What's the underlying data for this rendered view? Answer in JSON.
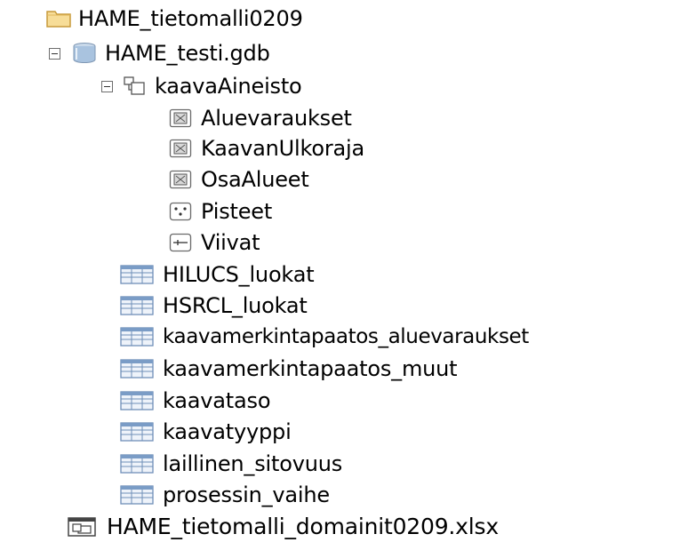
{
  "tree": {
    "root": {
      "label": "HAME_tietomalli0209",
      "icon": "folder-icon"
    },
    "gdb": {
      "label": "HAME_testi.gdb",
      "icon": "geodatabase-icon"
    },
    "dataset": {
      "label": "kaavaAineisto",
      "icon": "feature-dataset-icon"
    },
    "feature_classes": [
      {
        "label": "Aluevaraukset",
        "icon": "polygon-feature-class-icon"
      },
      {
        "label": "KaavanUlkoraja",
        "icon": "polygon-feature-class-icon"
      },
      {
        "label": "OsaAlueet",
        "icon": "polygon-feature-class-icon"
      },
      {
        "label": "Pisteet",
        "icon": "point-feature-class-icon"
      },
      {
        "label": "Viivat",
        "icon": "line-feature-class-icon"
      }
    ],
    "tables": [
      {
        "label": "HILUCS_luokat",
        "icon": "table-icon"
      },
      {
        "label": "HSRCL_luokat",
        "icon": "table-icon"
      },
      {
        "label": "kaavamerkintapaatos_aluevaraukset",
        "icon": "table-icon"
      },
      {
        "label": "kaavamerkintapaatos_muut",
        "icon": "table-icon"
      },
      {
        "label": "kaavataso",
        "icon": "table-icon"
      },
      {
        "label": "kaavatyyppi",
        "icon": "table-icon"
      },
      {
        "label": "laillinen_sitovuus",
        "icon": "table-icon"
      },
      {
        "label": "prosessin_vaihe",
        "icon": "table-icon"
      }
    ],
    "file": {
      "label": "HAME_tietomalli_domainit0209.xlsx",
      "icon": "excel-file-icon"
    }
  },
  "colors": {
    "folder": "#f5d78a",
    "folder_border": "#c79a3a",
    "db_blue": "#8fb3d9",
    "table_blue": "#7a9cc6"
  }
}
